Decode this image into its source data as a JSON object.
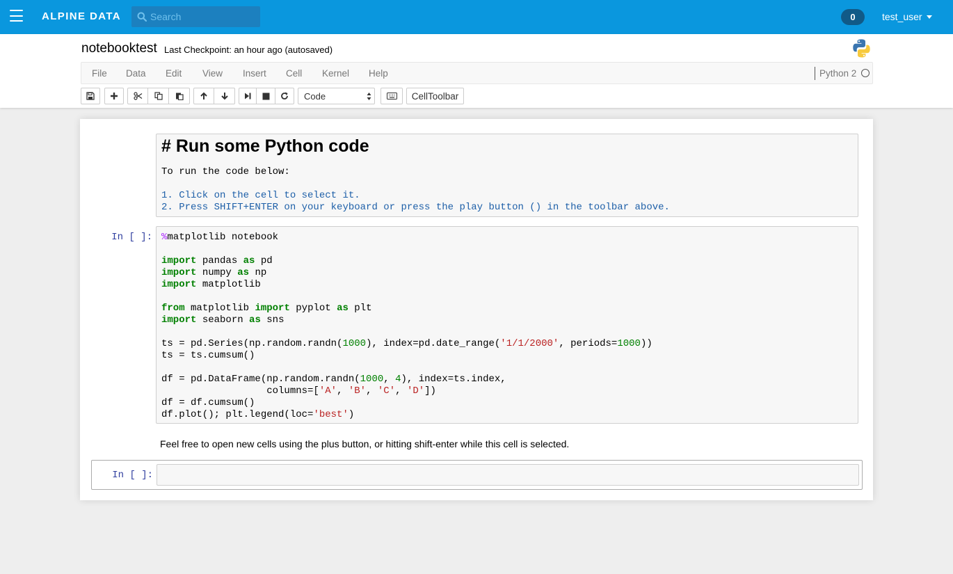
{
  "nav": {
    "brand": "ALPINE DATA",
    "search_placeholder": "Search",
    "notification_count": "0",
    "username": "test_user"
  },
  "header": {
    "notebook_name": "notebooktest",
    "checkpoint": "Last Checkpoint: an hour ago (autosaved)"
  },
  "menu": {
    "items": [
      "File",
      "Data",
      "Edit",
      "View",
      "Insert",
      "Cell",
      "Kernel",
      "Help"
    ],
    "kernel_name": "Python 2"
  },
  "toolbar": {
    "cell_type": "Code",
    "celltoolbar_label": "CellToolbar"
  },
  "cells": {
    "markdown": {
      "heading": "# Run some Python code",
      "intro": "To run the code below:",
      "step1": "1. Click on the cell to select it.",
      "step2": "2. Press SHIFT+ENTER on your keyboard or press the play button () in the toolbar above."
    },
    "code_prompt": "In [ ]:",
    "code_lines": [
      "%matplotlib notebook",
      "",
      "import pandas as pd",
      "import numpy as np",
      "import matplotlib",
      "",
      "from matplotlib import pyplot as plt",
      "import seaborn as sns",
      "",
      "ts = pd.Series(np.random.randn(1000), index=pd.date_range('1/1/2000', periods=1000))",
      "ts = ts.cumsum()",
      "",
      "df = pd.DataFrame(np.random.randn(1000, 4), index=ts.index,",
      "                  columns=['A', 'B', 'C', 'D'])",
      "df = df.cumsum()",
      "df.plot(); plt.legend(loc='best')"
    ],
    "info_text": "Feel free to open new cells using the plus button, or hitting shift-enter while this cell is selected.",
    "empty_prompt": "In [ ]:"
  }
}
